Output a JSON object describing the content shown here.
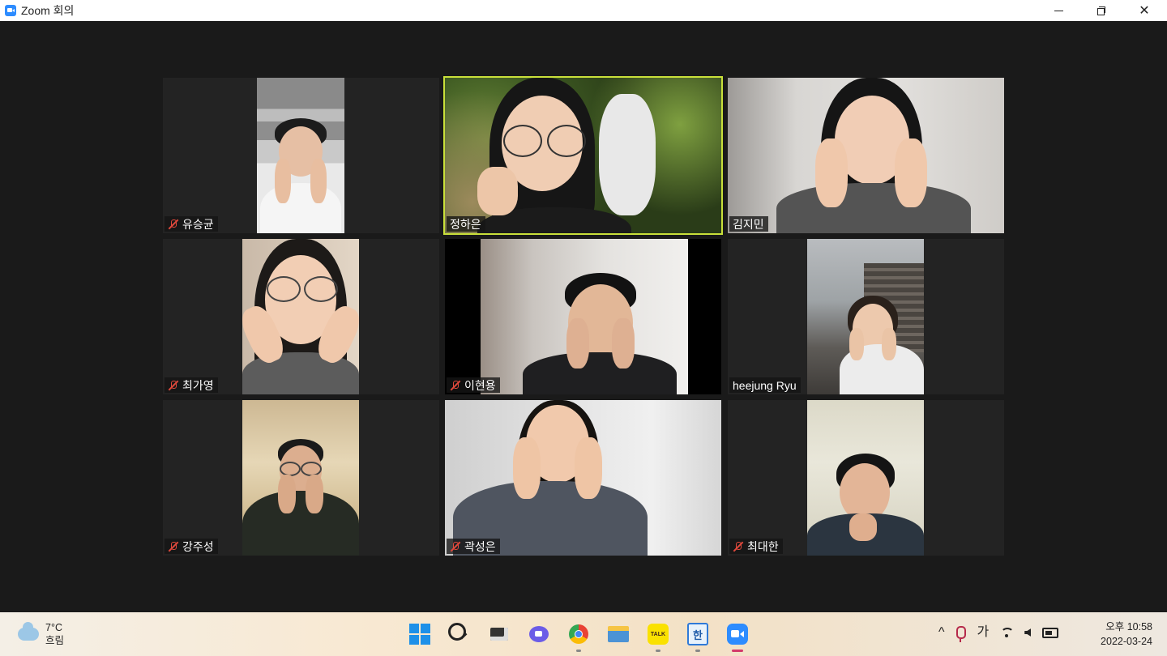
{
  "window": {
    "title": "Zoom 회의",
    "minimize_label": "—",
    "close_label": "✕"
  },
  "participants": [
    {
      "name": "유승균",
      "muted": true,
      "active": false
    },
    {
      "name": "정하은",
      "muted": false,
      "active": true
    },
    {
      "name": "김지민",
      "muted": false,
      "active": false
    },
    {
      "name": "최가영",
      "muted": true,
      "active": false
    },
    {
      "name": "이현용",
      "muted": true,
      "active": false
    },
    {
      "name": "heejung Ryu",
      "muted": false,
      "active": false
    },
    {
      "name": "강주성",
      "muted": true,
      "active": false
    },
    {
      "name": "곽성은",
      "muted": true,
      "active": false
    },
    {
      "name": "최대한",
      "muted": true,
      "active": false
    }
  ],
  "taskbar": {
    "weather": {
      "temp": "7°C",
      "condition": "흐림",
      "icon": "cloud-icon"
    },
    "apps": [
      {
        "name": "start",
        "icon": "windows-icon"
      },
      {
        "name": "search",
        "icon": "search-icon"
      },
      {
        "name": "task-view",
        "icon": "task-view-icon"
      },
      {
        "name": "teams-chat",
        "icon": "chat-icon"
      },
      {
        "name": "chrome",
        "icon": "chrome-icon"
      },
      {
        "name": "file-explorer",
        "icon": "folder-icon"
      },
      {
        "name": "kakaotalk",
        "icon": "kakaotalk-icon",
        "badge_text": "TALK"
      },
      {
        "name": "hangul",
        "icon": "hangul-icon",
        "badge_text": "한"
      },
      {
        "name": "zoom",
        "icon": "zoom-icon"
      }
    ],
    "tray": {
      "chevron": "^",
      "ime": "가",
      "time": "오후 10:58",
      "date": "2022-03-24"
    }
  },
  "colors": {
    "active_speaker": "#c9e03a",
    "mute": "#e0493c",
    "tile_bg": "#232323",
    "stage_bg": "#1a1a1a"
  }
}
